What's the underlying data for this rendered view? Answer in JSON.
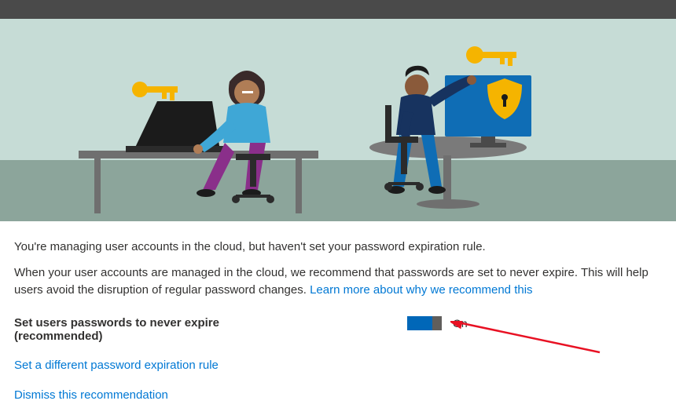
{
  "hero": {
    "alt": "Illustration of two people at desks with security keys and shield"
  },
  "intro_line": "You're managing user accounts in the cloud, but haven't set your password expiration rule.",
  "detail_text": "When your user accounts are managed in the cloud, we recommend that passwords are set to never expire. This will help users avoid the disruption of regular password changes. ",
  "learn_more_label": "Learn more about why we recommend this",
  "setting": {
    "label": "Set users passwords to never expire (recommended)",
    "state_label": "On",
    "on": true
  },
  "alt_rule_label": "Set a different password expiration rule",
  "dismiss_label": "Dismiss this recommendation"
}
